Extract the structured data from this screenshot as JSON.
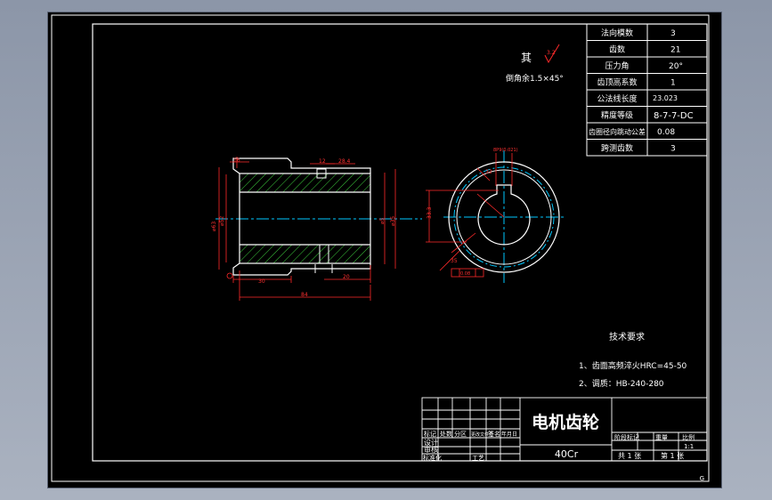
{
  "colors": {
    "background": "#000000",
    "frame": "#ffffff",
    "dimension": "#ff2a2a",
    "centerline": "#00c8ff",
    "hatch": "#3dcc3d",
    "outline": "#ffffff"
  },
  "param_table": [
    {
      "label": "法向模数",
      "value": "3"
    },
    {
      "label": "齿数",
      "value": "21"
    },
    {
      "label": "压力角",
      "value": "20°"
    },
    {
      "label": "齿顶高系数",
      "value": "1"
    },
    {
      "label": "公法线长度",
      "value": "23.023"
    },
    {
      "label": "精度等级",
      "value": "8-7-7-DC"
    },
    {
      "label": "齿圈径向跳动公差",
      "value": "0.08"
    },
    {
      "label": "跨测齿数",
      "value": "3"
    }
  ],
  "notes": {
    "rest_symbol": "其",
    "roughness": "3.2",
    "chamfer": "倒角余1.5×45°",
    "tech_title": "技术要求",
    "tech_items": [
      "1、齿面高频淬火HRC=45-50",
      "2、调质：HB-240-280"
    ]
  },
  "title_block": {
    "name": "电机齿轮",
    "material": "40Cr",
    "rev_headers": [
      "标记",
      "处数",
      "分区",
      "更改文件号",
      "签名",
      "年月日"
    ],
    "role_labels": [
      "设计",
      "审核",
      "标准化",
      "工艺"
    ],
    "stage_headers": [
      "阶段标记",
      "重量",
      "比例"
    ],
    "scale": "1:1",
    "sheet_total": "共 1 张",
    "sheet_num": "第 1 张"
  },
  "dimensions": {
    "side": {
      "top_left": "16",
      "groove_w": "12",
      "groove_off": "28.4",
      "od_outer": "⌀63",
      "od_inner": "⌀52",
      "bore": "⌀5",
      "hub": "⌀35",
      "bottom_left": "30",
      "bottom_right": "20",
      "overall": "84"
    },
    "front": {
      "keyway": "8P9(0.021)",
      "key_w": "32",
      "key_depth": "33.3",
      "chamfer": "35",
      "runout": "0.08"
    }
  },
  "corner_mark": "G"
}
